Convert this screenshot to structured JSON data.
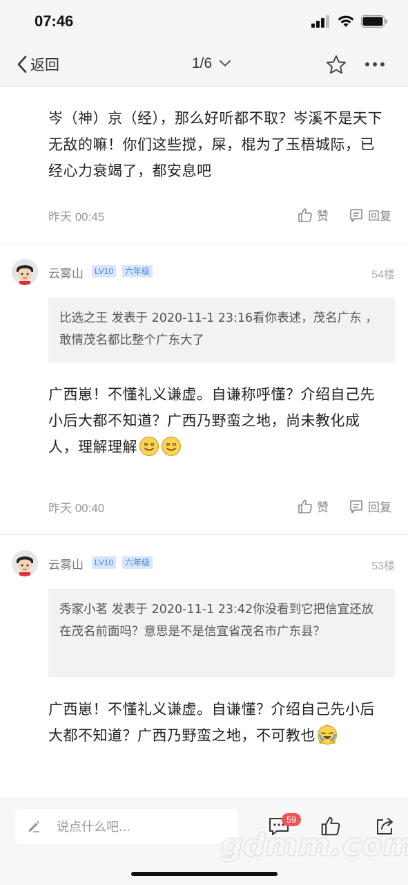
{
  "status_bar": {
    "time": "07:46"
  },
  "nav": {
    "back_label": "返回",
    "pager": "1/6"
  },
  "posts": [
    {
      "text": "岑（神）京（经），那么好听都不取？岑溪不是天下无敌的嘛！你们这些搅，屎，棍为了玉梧城际，已经心力衰竭了，都安息吧",
      "time": "昨天 00:45",
      "like_label": "赞",
      "reply_label": "回复"
    },
    {
      "username": "云雾山",
      "level": "LV10",
      "grade": "六年级",
      "floor": "54楼",
      "quote": "比选之王 发表于 2020-11-1 23:16看你表述，茂名广东 ，敢情茂名都比整个广东大了",
      "text": "广西崽！不懂礼义谦虚。自谦称呼懂？介绍自己先小后大都不知道？广西乃野蛮之地，尚未教化成人，理解理解",
      "time": "昨天 00:40",
      "like_label": "赞",
      "reply_label": "回复"
    },
    {
      "username": "云雾山",
      "level": "LV10",
      "grade": "六年级",
      "floor": "53楼",
      "quote": "秀家小茗 发表于 2020-11-1 23:42你没看到它把信宜还放在茂名前面吗？意思是不是信宜省茂名市广东县？",
      "text": "广西崽！不懂礼义谦虚。自谦懂？介绍自己先小后大都不知道？广西乃野蛮之地，不可教也"
    }
  ],
  "bottom": {
    "input_placeholder": "说点什么吧...",
    "comment_count": "59"
  },
  "watermark": "gdmm.com",
  "icons": [
    "back-icon",
    "chevron-down-icon",
    "star-icon",
    "more-icon",
    "like-icon",
    "reply-icon",
    "edit-icon",
    "comment-icon",
    "share-icon",
    "smile-emoji",
    "cry-laugh-emoji"
  ]
}
